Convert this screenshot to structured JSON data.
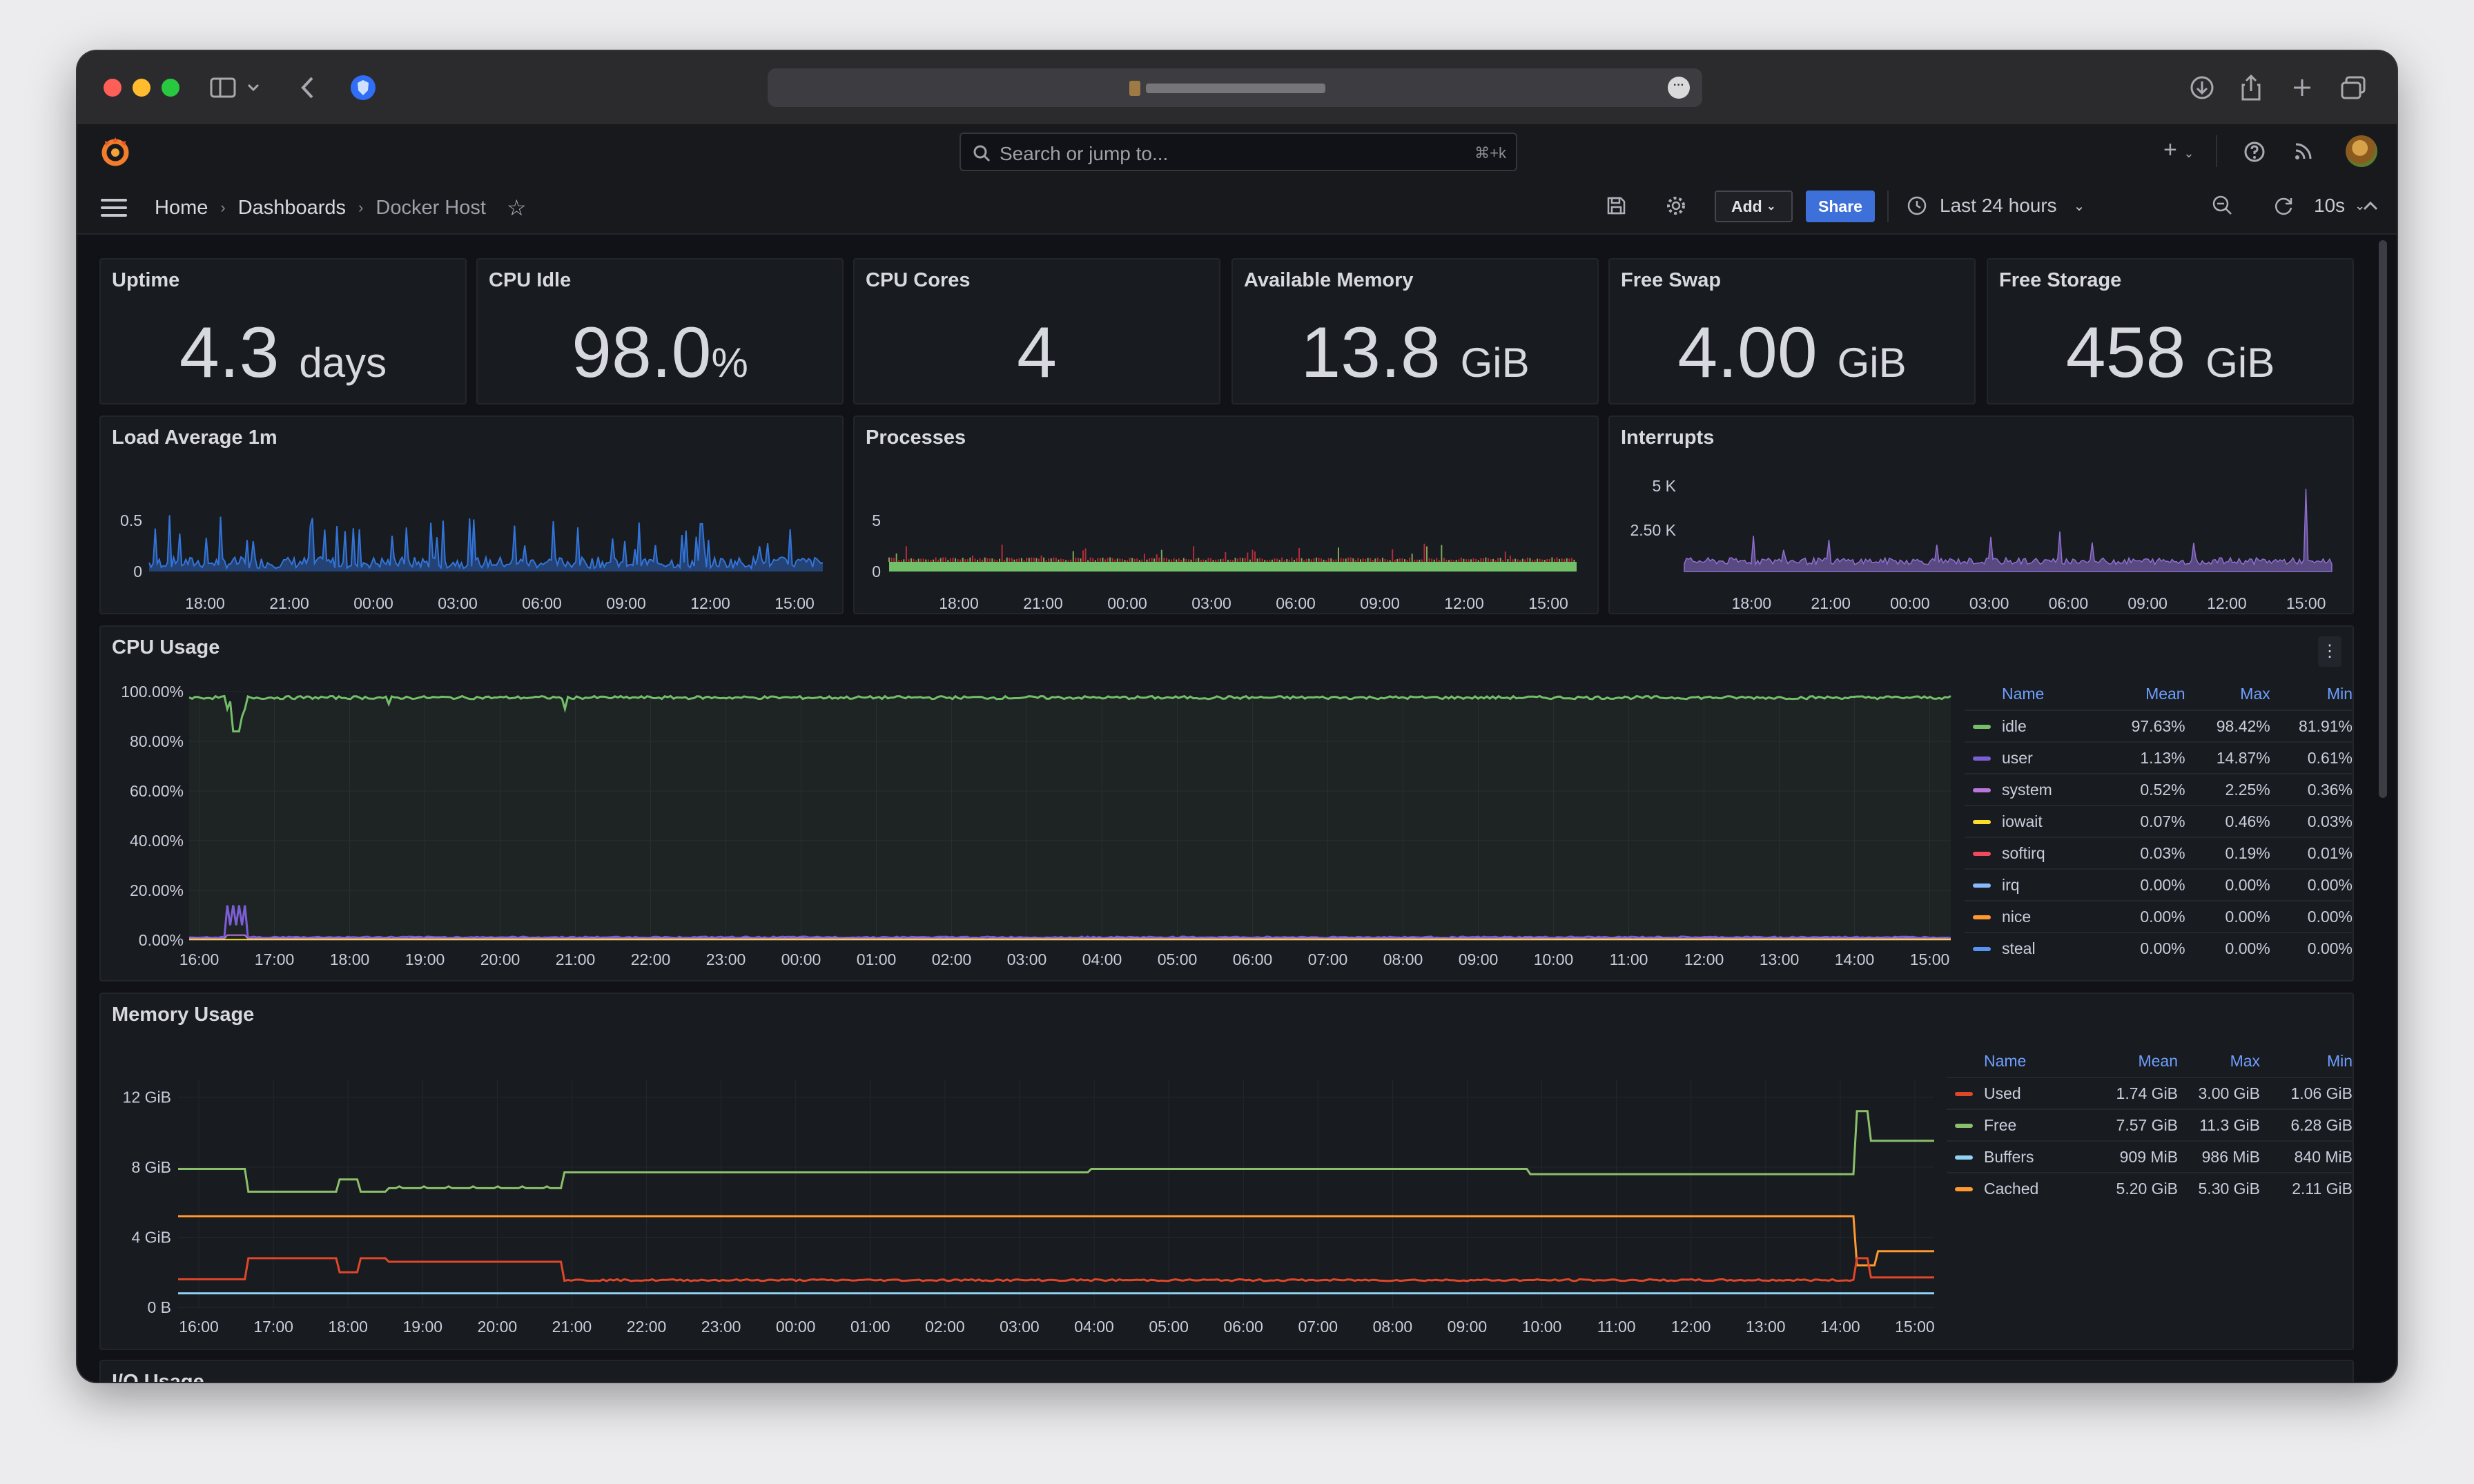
{
  "browser": {
    "url_text": ""
  },
  "nav": {
    "search_placeholder": "Search or jump to...",
    "search_shortcut": "⌘+k",
    "add_menu_label": "+"
  },
  "toolbar": {
    "breadcrumbs": [
      "Home",
      "Dashboards",
      "Docker Host"
    ],
    "add_label": "Add",
    "share_label": "Share",
    "time_range": "Last 24 hours",
    "refresh_interval": "10s"
  },
  "stats": [
    {
      "title": "Uptime",
      "value": "4.3",
      "unit": "days"
    },
    {
      "title": "CPU Idle",
      "value": "98.0",
      "unit": "%"
    },
    {
      "title": "CPU Cores",
      "value": "4",
      "unit": ""
    },
    {
      "title": "Available Memory",
      "value": "13.8",
      "unit": "GiB"
    },
    {
      "title": "Free Swap",
      "value": "4.00",
      "unit": "GiB"
    },
    {
      "title": "Free Storage",
      "value": "458",
      "unit": "GiB"
    }
  ],
  "time_ticks_small": [
    "18:00",
    "21:00",
    "00:00",
    "03:00",
    "06:00",
    "09:00",
    "12:00",
    "15:00"
  ],
  "time_ticks_hourly": [
    "16:00",
    "17:00",
    "18:00",
    "19:00",
    "20:00",
    "21:00",
    "22:00",
    "23:00",
    "00:00",
    "01:00",
    "02:00",
    "03:00",
    "04:00",
    "05:00",
    "06:00",
    "07:00",
    "08:00",
    "09:00",
    "10:00",
    "11:00",
    "12:00",
    "13:00",
    "14:00",
    "15:00"
  ],
  "colors": {
    "idle": "#73bf69",
    "user": "#7c5ed6",
    "system": "#b877d9",
    "iowait": "#fade2a",
    "softirq": "#f2495c",
    "irq": "#8ab8ff",
    "nice": "#ff9830",
    "steal": "#5794f2",
    "used": "#e0472a",
    "free": "#8bc06a",
    "buffers": "#8fd3f5",
    "cached": "#ff9830",
    "load": "#3274d9",
    "processes_running": "#73bf69",
    "processes_blocked": "#e02f44",
    "interrupts": "#8f6fd1"
  },
  "load_panel": {
    "title": "Load Average 1m",
    "yticks": [
      "0.5",
      "0"
    ]
  },
  "processes_panel": {
    "title": "Processes",
    "yticks": [
      "5",
      "0"
    ]
  },
  "interrupts_panel": {
    "title": "Interrupts",
    "yticks": [
      "5 K",
      "2.50 K"
    ]
  },
  "cpu_panel": {
    "title": "CPU Usage",
    "yticks": [
      "100.00%",
      "80.00%",
      "60.00%",
      "40.00%",
      "20.00%",
      "0.00%"
    ],
    "legend_headers": [
      "Name",
      "Mean",
      "Max",
      "Min"
    ],
    "legend": [
      {
        "name": "idle",
        "color_key": "idle",
        "mean": "97.63%",
        "max": "98.42%",
        "min": "81.91%"
      },
      {
        "name": "user",
        "color_key": "user",
        "mean": "1.13%",
        "max": "14.87%",
        "min": "0.61%"
      },
      {
        "name": "system",
        "color_key": "system",
        "mean": "0.52%",
        "max": "2.25%",
        "min": "0.36%"
      },
      {
        "name": "iowait",
        "color_key": "iowait",
        "mean": "0.07%",
        "max": "0.46%",
        "min": "0.03%"
      },
      {
        "name": "softirq",
        "color_key": "softirq",
        "mean": "0.03%",
        "max": "0.19%",
        "min": "0.01%"
      },
      {
        "name": "irq",
        "color_key": "irq",
        "mean": "0.00%",
        "max": "0.00%",
        "min": "0.00%"
      },
      {
        "name": "nice",
        "color_key": "nice",
        "mean": "0.00%",
        "max": "0.00%",
        "min": "0.00%"
      },
      {
        "name": "steal",
        "color_key": "steal",
        "mean": "0.00%",
        "max": "0.00%",
        "min": "0.00%"
      }
    ]
  },
  "memory_panel": {
    "title": "Memory Usage",
    "yticks": [
      "12 GiB",
      "8 GiB",
      "4 GiB",
      "0 B"
    ],
    "legend_headers": [
      "Name",
      "Mean",
      "Max",
      "Min"
    ],
    "legend": [
      {
        "name": "Used",
        "color_key": "used",
        "mean": "1.74 GiB",
        "max": "3.00 GiB",
        "min": "1.06 GiB"
      },
      {
        "name": "Free",
        "color_key": "free",
        "mean": "7.57 GiB",
        "max": "11.3 GiB",
        "min": "6.28 GiB"
      },
      {
        "name": "Buffers",
        "color_key": "buffers",
        "mean": "909 MiB",
        "max": "986 MiB",
        "min": "840 MiB"
      },
      {
        "name": "Cached",
        "color_key": "cached",
        "mean": "5.20 GiB",
        "max": "5.30 GiB",
        "min": "2.11 GiB"
      }
    ]
  },
  "io_panel": {
    "title": "I/O Usage"
  }
}
